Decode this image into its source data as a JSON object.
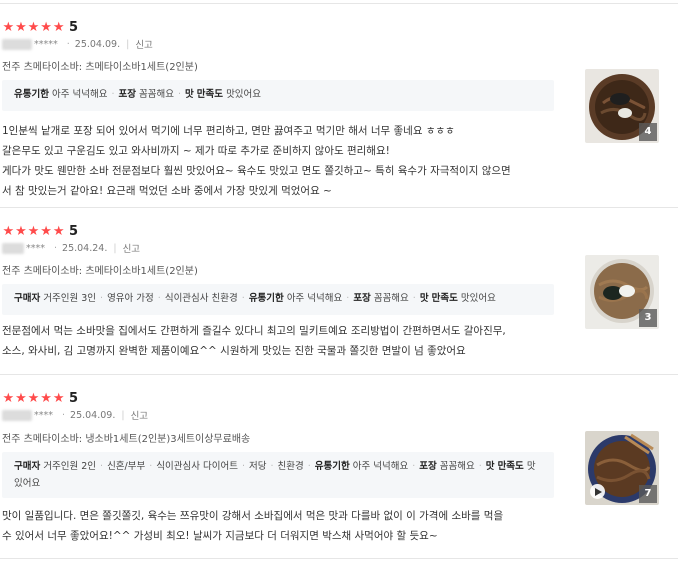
{
  "reviews": [
    {
      "rating": "5",
      "user_masked": "*****",
      "date": "25.04.09.",
      "report_label": "신고",
      "product": "전주 츠메타이소바: 츠메타이소바1세트(2인분)",
      "tags": [
        {
          "key": "유통기한",
          "value": "아주 넉넉해요"
        },
        {
          "key": "포장",
          "value": "꼼꼼해요"
        },
        {
          "key": "맛",
          "value": ""
        },
        {
          "key": "만족도",
          "value": "맛있어요"
        }
      ],
      "body_lines": [
        "1인분씩 낱개로 포장 되어 있어서 먹기에 너무 편리하고, 면만 끓여주고 먹기만 해서 너무 좋네요 ㅎㅎㅎ",
        "갈은무도 있고 구운김도 있고 와사비까지 ~ 제가 따로 추가로 준비하지 않아도 편리해요!",
        "게다가 맛도 웬만한 소바 전문점보다 훨씬 맛있어요~ 육수도 맛있고 면도 쫄깃하고~ 특히 육수가 자극적이지 않으면",
        "서 참 맛있는거 같아요! 요근래 먹었던 소바 중에서 가장 맛있게 먹었어요 ~"
      ],
      "photo_count": "4"
    },
    {
      "rating": "5",
      "user_masked": "****",
      "date": "25.04.24.",
      "report_label": "신고",
      "product": "전주 츠메타이소바: 츠메타이소바1세트(2인분)",
      "tags": [
        {
          "key": "구매자",
          "value": "거주인원 3인"
        },
        {
          "key": "",
          "value": "영유아 가정"
        },
        {
          "key": "",
          "value": "식이관심사 친환경"
        },
        {
          "key": "유통기한",
          "value": "아주 넉넉해요"
        },
        {
          "key": "포장",
          "value": "꼼꼼해요"
        },
        {
          "key": "맛",
          "value": ""
        },
        {
          "key": "만족도",
          "value": "맛있어요"
        }
      ],
      "body_lines": [
        "전문점에서 먹는 소바맛을 집에서도 간편하게 즐길수 있다니 최고의 밀키트예요 조리방법이 간편하면서도 갈아진무,",
        "소스, 와사비, 김 고명까지 완벽한 제품이예요^^ 시원하게 맛있는 진한 국물과 쫄깃한 면발이 넘 좋았어요"
      ],
      "photo_count": "3"
    },
    {
      "rating": "5",
      "user_masked": "****",
      "date": "25.04.09.",
      "report_label": "신고",
      "product": "전주 츠메타이소바: 냉소바1세트(2인분)3세트이상무료배송",
      "tags": [
        {
          "key": "구매자",
          "value": "거주인원 2인"
        },
        {
          "key": "",
          "value": "신혼/부부"
        },
        {
          "key": "",
          "value": "식이관심사 다이어트"
        },
        {
          "key": "",
          "value": "저당"
        },
        {
          "key": "",
          "value": "친환경"
        },
        {
          "key": "유통기한",
          "value": "아주 넉넉해요"
        },
        {
          "key": "포장",
          "value": "꼼꼼해요"
        },
        {
          "key": "맛",
          "value": ""
        },
        {
          "key": "만족도",
          "value": "맛있어요"
        }
      ],
      "body_lines": [
        "맛이 일품입니다. 면은 쫄깃쫄깃, 육수는 쯔유맛이 강해서 소바집에서 먹은 맛과 다를바 없이 이 가격에 소바를 먹을",
        "수 있어서 너무 좋았어요!^^ 가성비 최오! 날씨가 지금보다 더 더워지면 박스채 사먹어야 할 듯요~"
      ],
      "photo_count": "7",
      "has_video": true
    }
  ],
  "icons": {
    "star": "star-icon",
    "play": "play-icon"
  },
  "colors": {
    "star": "#ff4b4b",
    "tag_bg": "#f5f7f9",
    "divider": "#e6e6e6"
  }
}
